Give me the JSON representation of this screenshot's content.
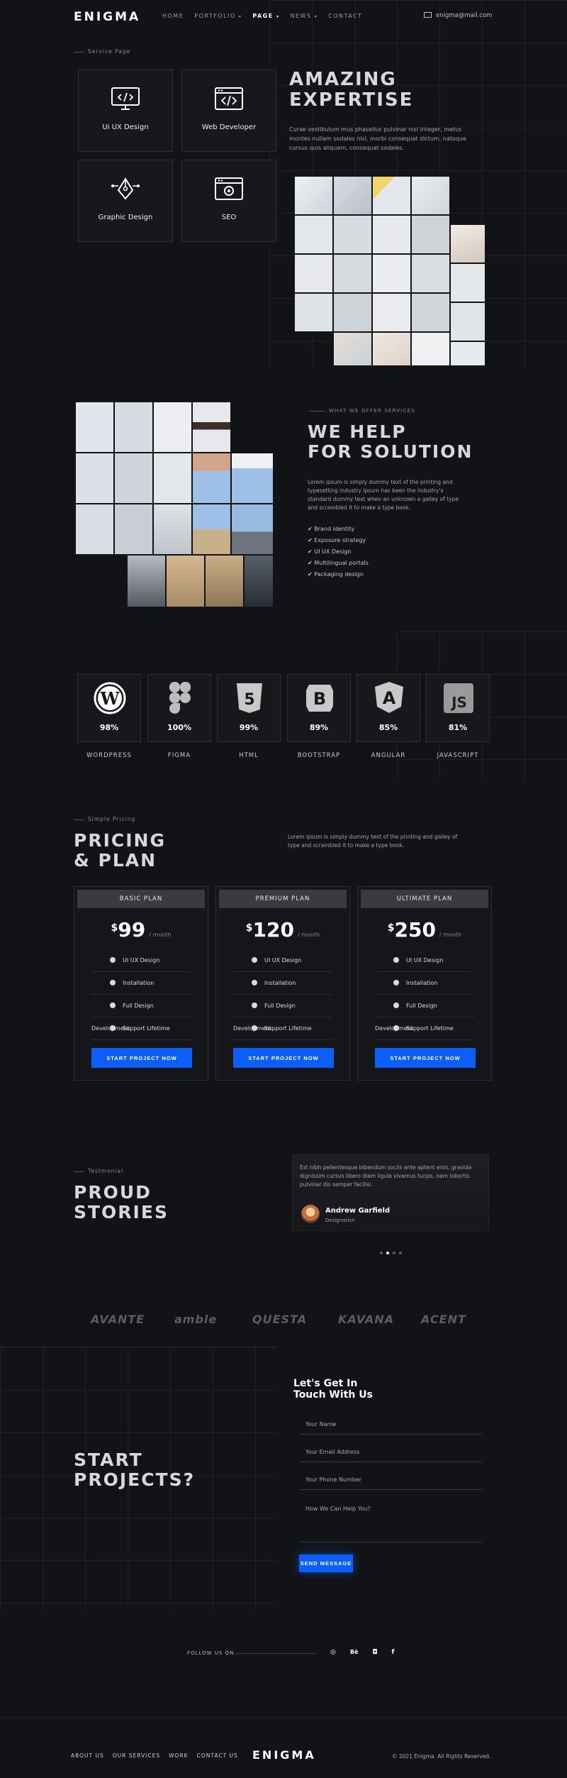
{
  "header": {
    "logo": "ENIGMA",
    "nav": [
      "HOME",
      "PORTFOLIO",
      "PAGE",
      "NEWS",
      "CONTACT"
    ],
    "email": "enigma@mail.com"
  },
  "services": {
    "eyebrow": "Service Page",
    "title_line1": "AMAZING",
    "title_line2": "EXPERTISE",
    "description": "Curae vestibulum mus phasellus pulvinar nisl integer, metus montes nullam sodales nisl, morbi consequat dictum, natoque cursus quis aliquam, consequat sodales.",
    "cards": [
      {
        "label": "Ui UX Design",
        "icon": "monitor-code-icon"
      },
      {
        "label": "Web Developer",
        "icon": "browser-code-icon"
      },
      {
        "label": "Graphic Design",
        "icon": "pen-tool-icon"
      },
      {
        "label": "SEO",
        "icon": "browser-settings-icon"
      }
    ]
  },
  "solutions": {
    "eyebrow": "WHAT WE OFFER SERVICES",
    "title_line1": "WE HELP",
    "title_line2": "FOR SOLUTION",
    "description": "Lorem ipsum is simply dummy text of the printing and typesetting industry ipsum has been the industry's standard dummy text when an unknown a galley of type and scrambled it to make a type book.",
    "checklist": [
      "Brand identity",
      "Exposure strategy",
      "UI UX Design",
      "Multilingual portals",
      "Packaging design"
    ]
  },
  "skills": [
    {
      "name": "WORDPRESS",
      "percent": "98%",
      "icon": "wordpress-icon"
    },
    {
      "name": "FIGMA",
      "percent": "100%",
      "icon": "figma-icon"
    },
    {
      "name": "HTML",
      "percent": "99%",
      "icon": "html5-icon"
    },
    {
      "name": "BOOTSTRAP",
      "percent": "89%",
      "icon": "bootstrap-icon"
    },
    {
      "name": "ANGULAR",
      "percent": "85%",
      "icon": "angular-icon"
    },
    {
      "name": "JAVASCRIPT",
      "percent": "81%",
      "icon": "javascript-icon"
    }
  ],
  "pricing": {
    "eyebrow": "Simple Pricing",
    "title_line1": "PRICING",
    "title_line2": "& PLAN",
    "description": "Lorem ipsum is simply dummy text of the printing and galley of type and scrambled it to make a type book.",
    "plans": [
      {
        "name": "BASIC PLAN",
        "currency": "$",
        "price": "99",
        "period": "/ month"
      },
      {
        "name": "PREMIUM PLAN",
        "currency": "$",
        "price": "120",
        "period": "/ month"
      },
      {
        "name": "ULTIMATE PLAN",
        "currency": "$",
        "price": "250",
        "period": "/ month"
      }
    ],
    "features": [
      "UI UX Design",
      "Installation",
      "Full Design Development",
      "Support Lifetime"
    ],
    "button_label": "START PROJECT NOW"
  },
  "testimonial": {
    "eyebrow": "Testmonial",
    "title_line1": "PROUD",
    "title_line2": "STORIES",
    "quote": "Est nibh pellentesque bibendum sociis ante aptent eros, gravida dignissim cursus libero diam ligula vivamus turpis, nam lobortis pulvinar dis semper facilisi.",
    "author": "Andrew Garfield",
    "role": "Designation",
    "slides": 4,
    "active_slide": 2
  },
  "partners": [
    "AVANTE",
    "amble",
    "QUESTA",
    "KAVANA",
    "ACENT"
  ],
  "contact": {
    "title_line1": "START",
    "title_line2": "PROJECTS?",
    "form_title_line1": "Let's Get In",
    "form_title_line2": "Touch With Us",
    "name_placeholder": "Your Name",
    "email_placeholder": "Your Email Address",
    "phone_placeholder": "Your Phone Number",
    "message_placeholder": "How We Can Help You?",
    "submit_label": "SEND MESSAGE"
  },
  "social": {
    "label": "FOLLOW US ON",
    "icons": [
      "dribbble-icon",
      "behance-icon",
      "instagram-icon",
      "facebook-icon"
    ]
  },
  "footer": {
    "links": [
      "ABOUT US",
      "OUR SERVICES",
      "WORK",
      "CONTACT US"
    ],
    "logo": "ENIGMA",
    "copyright": "© 2021 Enigma. All Rights Reserved."
  },
  "colors": {
    "background": "#121317",
    "accent_blue": "#0b5ff7",
    "card": "#17181c"
  }
}
